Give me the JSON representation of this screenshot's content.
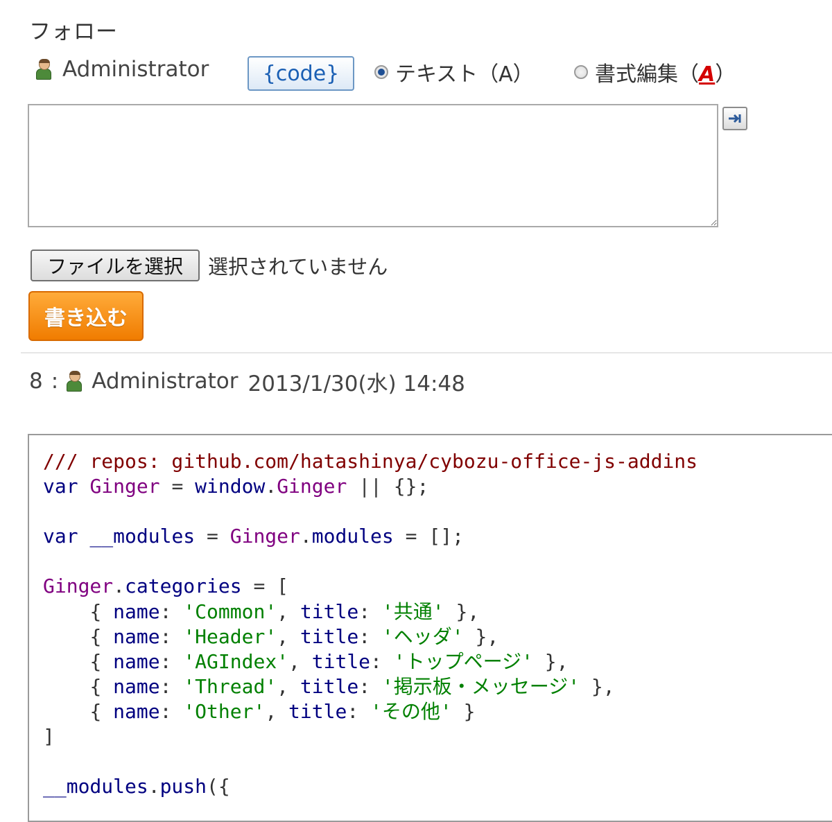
{
  "form": {
    "title": "フォロー",
    "user_name": "Administrator",
    "code_button": "{code}",
    "format_options": [
      {
        "label": "テキスト（A）",
        "checked": true
      },
      {
        "label_prefix": "書式編集（",
        "label_accent": "A",
        "label_suffix": "）",
        "checked": false
      }
    ],
    "textarea_value": "",
    "expand_icon": "arrow-right-to-bar-icon",
    "file_button": "ファイルを選択",
    "file_status": "選択されていません",
    "submit_label": "書き込む",
    "submit_color": "#f5890f",
    "accent_color": "#1a5fb4"
  },
  "post": {
    "number": "8",
    "separator": ":",
    "author": "Administrator",
    "datetime": "2013/1/30(水) 14:48",
    "code_lines": [
      "/// repos: github.com/hatashinya/cybozu-office-js-addins",
      "var Ginger = window.Ginger || {};",
      "",
      "var __modules = Ginger.modules = [];",
      "",
      "Ginger.categories = [",
      "    { name: 'Common', title: '共通' },",
      "    { name: 'Header', title: 'ヘッダ' },",
      "    { name: 'AGIndex', title: 'トップページ' },",
      "    { name: 'Thread', title: '掲示板・メッセージ' },",
      "    { name: 'Other', title: 'その他' }",
      "]",
      "",
      "__modules.push({"
    ]
  }
}
